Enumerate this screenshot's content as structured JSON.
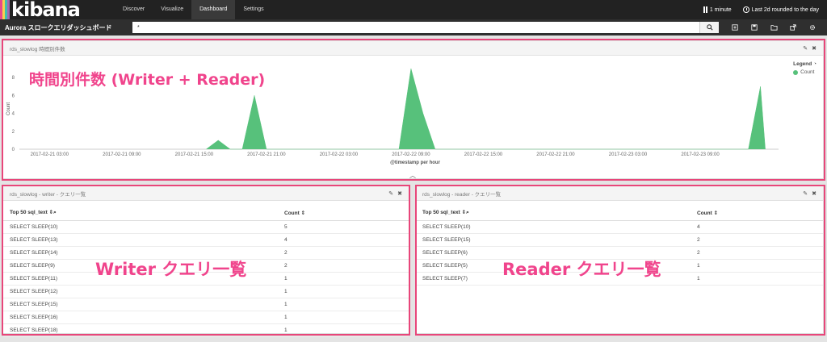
{
  "app": {
    "logo": "kibana",
    "logo_colors": [
      "#e8478b",
      "#f6d04d",
      "#3ebeb0",
      "#9f6cb0"
    ]
  },
  "nav": {
    "links": [
      "Discover",
      "Visualize",
      "Dashboard",
      "Settings"
    ],
    "active": "Dashboard",
    "refresh_interval": "1 minute",
    "time_range": "Last 2d rounded to the day"
  },
  "dashboard": {
    "title": "Aurora スロークエリダッシュボード",
    "query": "*"
  },
  "panel_top": {
    "title": "rds_slowlog 時間別件数",
    "annotation": "時間別件数 (Writer + Reader)",
    "legend_title": "Legend",
    "legend_item": "Count",
    "series_color": "#57c17b"
  },
  "chart_data": {
    "type": "area",
    "x_label": "@timestamp per hour",
    "y_label": "Count",
    "y_ticks": [
      "0",
      "2",
      "4",
      "6",
      "8"
    ],
    "ylim": [
      0,
      9
    ],
    "x_tick_labels": [
      "2017-02-21 03:00",
      "2017-02-21 09:00",
      "2017-02-21 15:00",
      "2017-02-21 21:00",
      "2017-02-22 03:00",
      "2017-02-22 09:00",
      "2017-02-22 15:00",
      "2017-02-22 21:00",
      "2017-02-23 03:00",
      "2017-02-23 09:00"
    ],
    "x_tick_hours": [
      3,
      9,
      15,
      21,
      27,
      33,
      39,
      45,
      51,
      57
    ],
    "xlim_hours": [
      0.5,
      63.5
    ],
    "grid": false,
    "legend": "top-right",
    "series": [
      {
        "name": "Count",
        "points": [
          [
            16,
            0
          ],
          [
            17,
            1
          ],
          [
            18,
            0
          ],
          [
            19,
            0
          ],
          [
            20,
            6
          ],
          [
            21,
            0
          ],
          [
            32,
            0
          ],
          [
            33,
            9
          ],
          [
            34,
            4
          ],
          [
            35,
            0
          ],
          [
            61,
            0
          ],
          [
            62,
            7
          ],
          [
            62.4,
            0
          ]
        ]
      }
    ]
  },
  "panel_writer": {
    "title": "rds_slowlog - writer - クエリ一覧",
    "annotation": "Writer クエリ一覧",
    "columns": [
      "Top 50 sql_text",
      "Count"
    ],
    "rows": [
      [
        "SELECT SLEEP(10)",
        "5"
      ],
      [
        "SELECT SLEEP(13)",
        "4"
      ],
      [
        "SELECT SLEEP(14)",
        "2"
      ],
      [
        "SELECT SLEEP(9)",
        "2"
      ],
      [
        "SELECT SLEEP(11)",
        "1"
      ],
      [
        "SELECT SLEEP(12)",
        "1"
      ],
      [
        "SELECT SLEEP(15)",
        "1"
      ],
      [
        "SELECT SLEEP(16)",
        "1"
      ],
      [
        "SELECT SLEEP(18)",
        "1"
      ]
    ]
  },
  "panel_reader": {
    "title": "rds_slowlog - reader - クエリ一覧",
    "annotation": "Reader クエリ一覧",
    "columns": [
      "Top 50 sql_text",
      "Count"
    ],
    "rows": [
      [
        "SELECT SLEEP(10)",
        "4"
      ],
      [
        "SELECT SLEEP(15)",
        "2"
      ],
      [
        "SELECT SLEEP(6)",
        "2"
      ],
      [
        "SELECT SLEEP(5)",
        "1"
      ],
      [
        "SELECT SLEEP(7)",
        "1"
      ]
    ]
  }
}
